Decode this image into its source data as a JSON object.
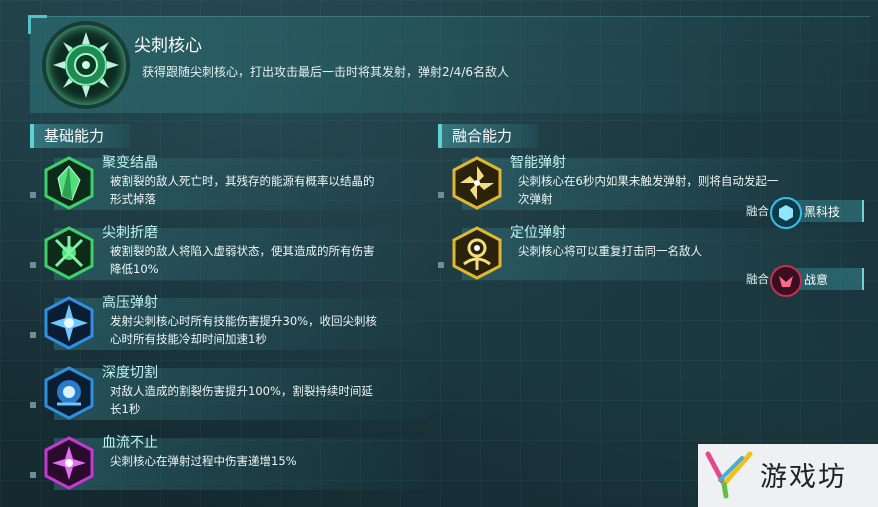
{
  "core": {
    "title": "尖刺核心",
    "description": "获得跟随尖刺核心，打出攻击最后一击时将其发射，弹射2/4/6名敌人",
    "icon": "spiked-core-icon"
  },
  "basic": {
    "heading": "基础能力",
    "items": [
      {
        "name": "聚变结晶",
        "desc1": "被割裂的敌人死亡时，其残存的能源有概率以结晶的",
        "desc2": "形式掉落",
        "icon": "green-crystal-icon",
        "color": "#3fd06a"
      },
      {
        "name": "尖刺折磨",
        "desc1": "被割裂的敌人将陷入虚弱状态，使其造成的所有伤害",
        "desc2": "降低10%",
        "icon": "green-thorn-icon",
        "color": "#3fd06a"
      },
      {
        "name": "高压弹射",
        "desc1": "发射尖刺核心时所有技能伤害提升30%，收回尖刺核",
        "desc2": "心时所有技能冷却时间加速1秒",
        "icon": "blue-burst-icon",
        "color": "#2f8fe0"
      },
      {
        "name": "深度切割",
        "desc1": "对敌人造成的割裂伤害提升100%，割裂持续时间延",
        "desc2": "长1秒",
        "icon": "blue-core-icon",
        "color": "#2f8fe0"
      },
      {
        "name": "血流不止",
        "desc1": "尖刺核心在弹射过程中伤害递增15%",
        "desc2": "",
        "icon": "purple-star-icon",
        "color": "#c23ad0"
      }
    ]
  },
  "fusion": {
    "heading": "融合能力",
    "items": [
      {
        "name": "智能弹射",
        "desc1": "尖刺核心在6秒内如果未触发弹射，则将自动发起一",
        "desc2": "次弹射",
        "icon": "gold-pinwheel-icon",
        "color": "#e0b830"
      },
      {
        "name": "定位弹射",
        "desc1": "尖刺核心将可以重复打击同一名敌人",
        "desc2": "",
        "icon": "gold-target-icon",
        "color": "#e0b830"
      }
    ],
    "tags": [
      {
        "label": "融合",
        "name": "黑科技",
        "icon": "tech-icon",
        "color": "#3ac0e8"
      },
      {
        "label": "融合",
        "name": "战意",
        "icon": "battle-will-icon",
        "color": "#c8304a"
      }
    ]
  },
  "watermark": {
    "text": "游戏坊"
  }
}
